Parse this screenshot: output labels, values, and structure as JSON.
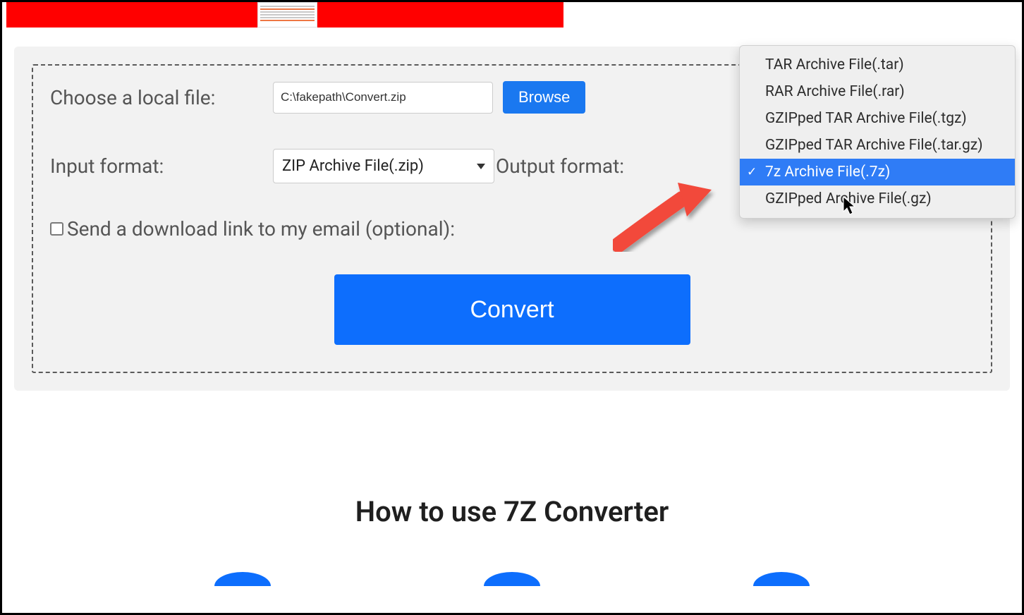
{
  "form": {
    "choose_label": "Choose a local file:",
    "file_value": "C:\\fakepath\\Convert.zip",
    "browse_label": "Browse",
    "input_format_label": "Input format:",
    "input_format_value": "ZIP Archive File(.zip)",
    "output_format_label": "Output format:",
    "email_label": "Send a download link to my email (optional):",
    "convert_label": "Convert"
  },
  "dropdown": {
    "items": [
      "TAR Archive File(.tar)",
      "RAR Archive File(.rar)",
      "GZIPped TAR Archive File(.tgz)",
      "GZIPped TAR Archive File(.tar.gz)",
      "7z Archive File(.7z)",
      "GZIPped Archive File(.gz)"
    ],
    "selected_index": 4
  },
  "heading": "How to use 7Z Converter"
}
